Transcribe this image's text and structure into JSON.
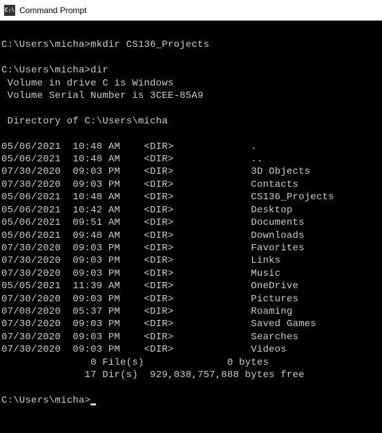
{
  "titlebar": {
    "icon_label": "C:\\",
    "title": "Command Prompt"
  },
  "terminal": {
    "prompt": "C:\\Users\\micha>",
    "cmd_mkdir": "mkdir CS136_Projects",
    "cmd_dir": "dir",
    "volume_line": " Volume in drive C is Windows",
    "serial_line": " Volume Serial Number is 3CEE-85A9",
    "directory_of": " Directory of C:\\Users\\micha",
    "entries": [
      {
        "date": "05/06/2021",
        "time": "10:48 AM",
        "type": "<DIR>",
        "name": "."
      },
      {
        "date": "05/06/2021",
        "time": "10:48 AM",
        "type": "<DIR>",
        "name": ".."
      },
      {
        "date": "07/30/2020",
        "time": "09:03 PM",
        "type": "<DIR>",
        "name": "3D Objects"
      },
      {
        "date": "07/30/2020",
        "time": "09:03 PM",
        "type": "<DIR>",
        "name": "Contacts"
      },
      {
        "date": "05/06/2021",
        "time": "10:48 AM",
        "type": "<DIR>",
        "name": "CS136_Projects"
      },
      {
        "date": "05/06/2021",
        "time": "10:42 AM",
        "type": "<DIR>",
        "name": "Desktop"
      },
      {
        "date": "05/06/2021",
        "time": "09:51 AM",
        "type": "<DIR>",
        "name": "Documents"
      },
      {
        "date": "05/06/2021",
        "time": "09:48 AM",
        "type": "<DIR>",
        "name": "Downloads"
      },
      {
        "date": "07/30/2020",
        "time": "09:03 PM",
        "type": "<DIR>",
        "name": "Favorites"
      },
      {
        "date": "07/30/2020",
        "time": "09:03 PM",
        "type": "<DIR>",
        "name": "Links"
      },
      {
        "date": "07/30/2020",
        "time": "09:03 PM",
        "type": "<DIR>",
        "name": "Music"
      },
      {
        "date": "05/05/2021",
        "time": "11:39 AM",
        "type": "<DIR>",
        "name": "OneDrive"
      },
      {
        "date": "07/30/2020",
        "time": "09:03 PM",
        "type": "<DIR>",
        "name": "Pictures"
      },
      {
        "date": "07/08/2020",
        "time": "05:37 PM",
        "type": "<DIR>",
        "name": "Roaming"
      },
      {
        "date": "07/30/2020",
        "time": "09:03 PM",
        "type": "<DIR>",
        "name": "Saved Games"
      },
      {
        "date": "07/30/2020",
        "time": "09:03 PM",
        "type": "<DIR>",
        "name": "Searches"
      },
      {
        "date": "07/30/2020",
        "time": "09:03 PM",
        "type": "<DIR>",
        "name": "Videos"
      }
    ],
    "summary_files": "               0 File(s)              0 bytes",
    "summary_dirs": "              17 Dir(s)  929,038,757,888 bytes free"
  }
}
